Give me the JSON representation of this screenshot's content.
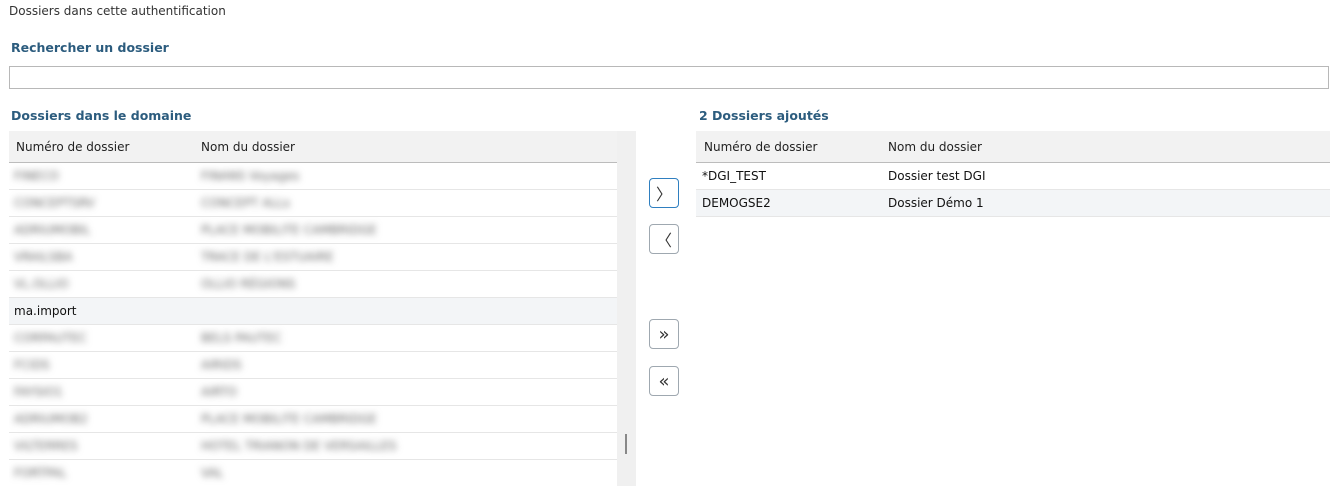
{
  "page": {
    "title": "Dossiers dans cette authentification"
  },
  "search": {
    "label": "Rechercher un dossier",
    "value": "",
    "placeholder": ""
  },
  "left": {
    "heading": "Dossiers dans le domaine",
    "columns": [
      "Numéro de dossier",
      "Nom du dossier"
    ],
    "rows": [
      {
        "number": "FINECO",
        "name": "FINANS Voyages",
        "blurred": true
      },
      {
        "number": "CONCEPTSRV",
        "name": "CONCEPT ALLs",
        "blurred": true
      },
      {
        "number": "ADRIUMOBIL",
        "name": "PLACE MOBILITE CAMBRIDGE",
        "blurred": true
      },
      {
        "number": "VRAILSBA",
        "name": "TRACE DE L'ESTUAIRE",
        "blurred": true
      },
      {
        "number": "VL.OLLIO",
        "name": "OLLIO RÉGIONS",
        "blurred": true
      },
      {
        "number": "ma.import",
        "name": "",
        "blurred": false
      },
      {
        "number": "CORPAUTEC",
        "name": "BELS PAUTEC",
        "blurred": true
      },
      {
        "number": "FCIDS",
        "name": "AIRIDS",
        "blurred": true
      },
      {
        "number": "FAYSIO1",
        "name": "AIRTO",
        "blurred": true
      },
      {
        "number": "ADRIUMOB2",
        "name": "PLACE MOBILITE CAMBRIDGE",
        "blurred": true
      },
      {
        "number": "VILTERRES",
        "name": "HOTEL TRIANON DE VERSAILLES",
        "blurred": true
      },
      {
        "number": "FORTPAL",
        "name": "VAL",
        "blurred": true
      }
    ]
  },
  "right": {
    "heading": "2 Dossiers ajoutés",
    "columns": [
      "Numéro de dossier",
      "Nom du dossier"
    ],
    "rows": [
      {
        "number": "*DGI_TEST",
        "name": "Dossier test DGI"
      },
      {
        "number": "DEMOGSE2",
        "name": "Dossier Démo 1"
      }
    ]
  },
  "buttons": {
    "add_one": "〉",
    "remove_one": "〈",
    "add_all": "»",
    "remove_all": "«"
  }
}
